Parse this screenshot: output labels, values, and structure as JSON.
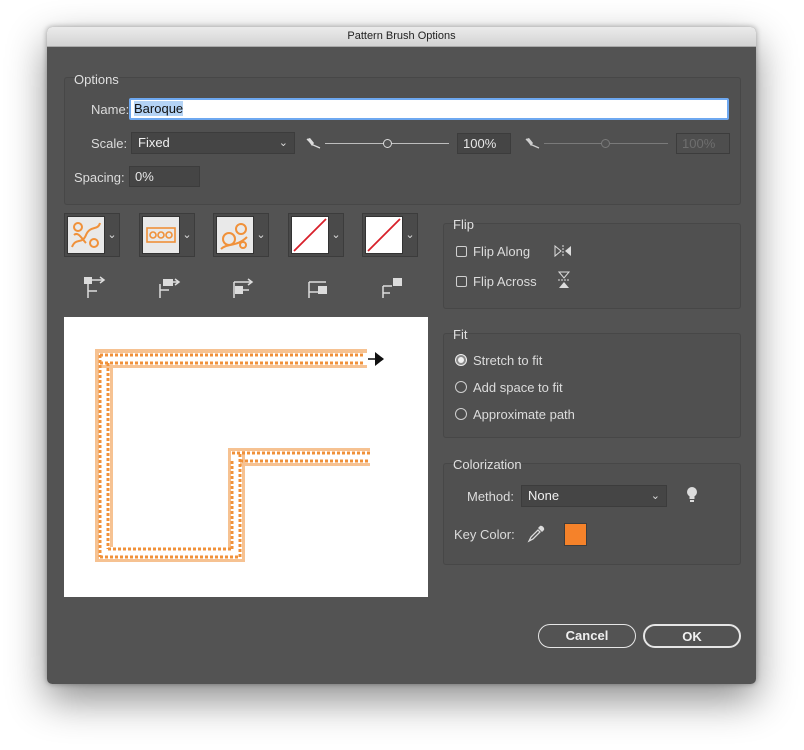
{
  "dialog": {
    "title": "Pattern Brush Options"
  },
  "options": {
    "section_title": "Options",
    "name_label": "Name:",
    "name_value": "Baroque",
    "scale_label": "Scale:",
    "scale_value": "Fixed",
    "scale_percent_1": "100%",
    "scale_percent_2": "100%",
    "spacing_label": "Spacing:",
    "spacing_value": "0%"
  },
  "tiles": [
    {
      "name": "side-tile",
      "state": "pattern"
    },
    {
      "name": "outer-corner-tile",
      "state": "pattern"
    },
    {
      "name": "inner-corner-tile",
      "state": "pattern"
    },
    {
      "name": "start-tile",
      "state": "none"
    },
    {
      "name": "end-tile",
      "state": "none"
    }
  ],
  "flip": {
    "section_title": "Flip",
    "along_label": "Flip Along",
    "across_label": "Flip Across",
    "along_checked": false,
    "across_checked": false
  },
  "fit": {
    "section_title": "Fit",
    "options": [
      "Stretch to fit",
      "Add space to fit",
      "Approximate path"
    ],
    "selected": "Stretch to fit"
  },
  "colorization": {
    "section_title": "Colorization",
    "method_label": "Method:",
    "method_value": "None",
    "key_color_label": "Key Color:",
    "key_color": "#f5822a"
  },
  "buttons": {
    "cancel": "Cancel",
    "ok": "OK"
  },
  "colors": {
    "dialog_bg": "#535353",
    "pattern_orange": "#f0913a",
    "focus_blue": "#6ea8f0"
  }
}
